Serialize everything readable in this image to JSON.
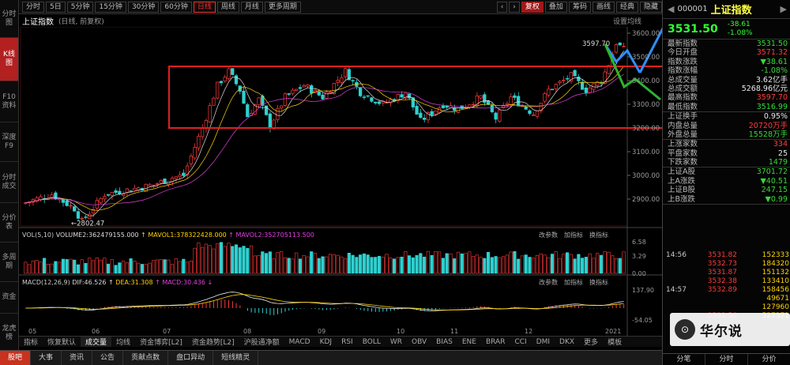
{
  "leftnav": [
    {
      "label": "分时图",
      "active": false
    },
    {
      "label": "K线图",
      "active": true
    },
    {
      "label": "F10资料",
      "active": false
    },
    {
      "label": "深度F9",
      "active": false
    },
    {
      "label": "分时成交",
      "active": false
    },
    {
      "label": "分价表",
      "active": false
    },
    {
      "label": "多周期",
      "active": false
    },
    {
      "label": "资金",
      "active": false
    },
    {
      "label": "龙虎榜",
      "active": false
    }
  ],
  "toolbar": {
    "periods": [
      "分时",
      "5日",
      "5分钟",
      "15分钟",
      "30分钟",
      "60分钟",
      "日线",
      "周线",
      "月线",
      "更多周期"
    ],
    "active_period": "日线",
    "right": [
      "复权",
      "叠加",
      "筹码",
      "画线",
      "经典",
      "隐藏"
    ]
  },
  "subhead": {
    "index": "上证指数",
    "mode": "(日线, 前复权)",
    "setting": "设置均线"
  },
  "price_axis": [
    "3600.00",
    "3500.00",
    "3400.00",
    "3300.00",
    "3200.00",
    "3100.00",
    "3000.00",
    "2900.00"
  ],
  "high_label": "3597.70",
  "low_label": "2802.47",
  "vol_line": {
    "title": "VOL(5,10)",
    "vol": "VOLUME2:362479155.000",
    "m1": "MAVOL1:378322428.000",
    "m2": "MAVOL2:352705113.500",
    "actions": [
      "改参数",
      "加指标",
      "换指标"
    ]
  },
  "vol_axis": [
    "6.58",
    "3.29",
    "0.00"
  ],
  "macd_line": {
    "title": "MACD(12,26,9)",
    "dif": "DIF:46.526",
    "dea": "DEA:31.308",
    "macd": "MACD:30.436",
    "actions": [
      "改参数",
      "加指标",
      "换指标"
    ]
  },
  "macd_axis": [
    "137.90",
    "-54.05"
  ],
  "date_axis": [
    "05",
    "06",
    "07",
    "08",
    "09",
    "10",
    "11",
    "12",
    "2021"
  ],
  "indicators": [
    "指标",
    "恢复默认",
    "成交量",
    "均线",
    "资金博弈[L2]",
    "资金趋势[L2]",
    "沪股通净额",
    "MACD",
    "KDJ",
    "RSI",
    "BOLL",
    "WR",
    "OBV",
    "BIAS",
    "ENE",
    "BRAR",
    "CCI",
    "DMI",
    "DKX",
    "更多",
    "模板"
  ],
  "bottombar": [
    "股吧",
    "大事",
    "资讯",
    "公告",
    "贡献点数",
    "盘口异动",
    "短线精灵"
  ],
  "panel": {
    "code": "000001",
    "name": "上证指数",
    "price": "3531.50",
    "change": "-38.61",
    "change_pct": "-1.08%",
    "stats": [
      {
        "k": "最新指数",
        "v": "3531.50",
        "c": "grn"
      },
      {
        "k": "今日开盘",
        "v": "3571.32",
        "c": "red"
      },
      {
        "k": "指数涨跌",
        "v": "▼38.61",
        "c": "grn"
      },
      {
        "k": "指数涨幅",
        "v": "-1.08%",
        "c": "grn"
      },
      {
        "k": "总成交量",
        "v": "3.62亿手",
        "c": "wht"
      },
      {
        "k": "总成交额",
        "v": "5268.96亿元",
        "c": "wht"
      },
      {
        "k": "最高指数",
        "v": "3597.70",
        "c": "red"
      },
      {
        "k": "最低指数",
        "v": "3516.99",
        "c": "grn"
      }
    ],
    "stats2": [
      {
        "k": "上证换手",
        "v": "0.95%",
        "c": "wht"
      },
      {
        "k": "内盘总量",
        "v": "20720万手",
        "c": "red"
      },
      {
        "k": "外盘总量",
        "v": "15528万手",
        "c": "grn"
      }
    ],
    "stats3": [
      {
        "k": "上涨家数",
        "v": "334",
        "c": "red"
      },
      {
        "k": "平盘家数",
        "v": "25",
        "c": "wht"
      },
      {
        "k": "下跌家数",
        "v": "1479",
        "c": "grn"
      }
    ],
    "stats4": [
      {
        "k": "上证A股",
        "v": "3701.72",
        "c": "grn"
      },
      {
        "k": "上A涨跌",
        "v": "▼40.51",
        "c": "grn"
      },
      {
        "k": "上证B股",
        "v": "247.15",
        "c": "grn"
      },
      {
        "k": "上B涨跌",
        "v": "▼0.99",
        "c": "grn"
      }
    ],
    "ticks": [
      {
        "t": "14:56",
        "p": "3531.82",
        "v": "152333"
      },
      {
        "t": "",
        "p": "3532.73",
        "v": "184320"
      },
      {
        "t": "",
        "p": "3531.87",
        "v": "151132"
      },
      {
        "t": "",
        "p": "3532.38",
        "v": "133410"
      },
      {
        "t": "14:57",
        "p": "3532.89",
        "v": "158456"
      },
      {
        "t": "",
        "p": "",
        "v": "49671"
      },
      {
        "t": "",
        "p": "",
        "v": "127960"
      },
      {
        "t": "",
        "p": "3531.50",
        "v": "527371"
      }
    ],
    "tabs": [
      "分笔",
      "分时",
      "分价"
    ]
  },
  "watermark": "华尔说",
  "colors": {
    "up": "#ff3b3b",
    "down": "#2fd0d0",
    "box": "#e02020",
    "arrow_up": "#2f8fff",
    "arrow_down": "#2db52d"
  }
}
